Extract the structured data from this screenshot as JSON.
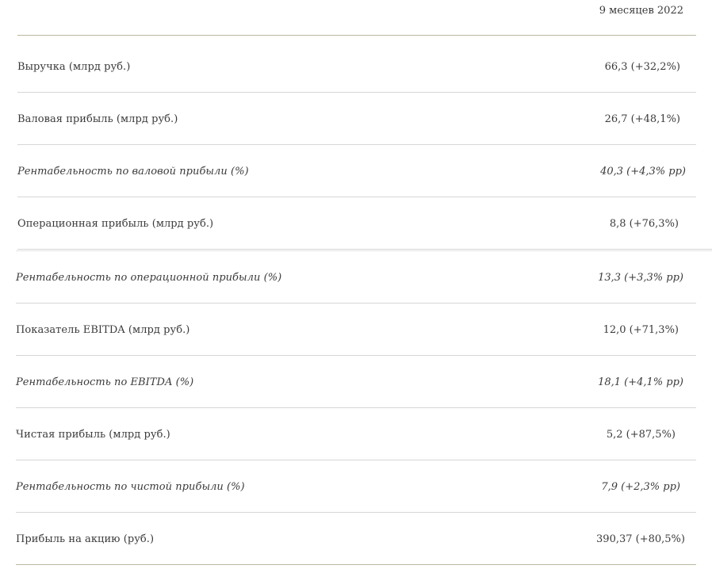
{
  "table": {
    "period_header": "9 месяцев 2022",
    "rows": [
      {
        "label": "Выручка (млрд руб.)",
        "value": "66,3 (+32,2%)",
        "italic": false
      },
      {
        "label": "Валовая прибыль (млрд руб.)",
        "value": "26,7 (+48,1%)",
        "italic": false
      },
      {
        "label": "Рентабельность по валовой прибыли (%)",
        "value": "40,3 (+4,3% pp)",
        "italic": true
      },
      {
        "label": "Операционная прибыль (млрд руб.)",
        "value": "8,8 (+76,3%)",
        "italic": false
      },
      {
        "label": "Рентабельность по операционной прибыли (%)",
        "value": "13,3 (+3,3% pp)",
        "italic": true
      },
      {
        "label": "Показатель EBITDA (млрд руб.)",
        "value": "12,0 (+71,3%)",
        "italic": false
      },
      {
        "label": "Рентабельность по EBITDA (%)",
        "value": "18,1 (+4,1% pp)",
        "italic": true
      },
      {
        "label": "Чистая прибыль (млрд руб.)",
        "value": "5,2 (+87,5%)",
        "italic": false
      },
      {
        "label": "Рентабельность по чистой прибыли (%)",
        "value": "7,9 (+2,3% pp)",
        "italic": true
      },
      {
        "label": "Прибыль на акцию (руб.)",
        "value": "390,37 (+80,5%)",
        "italic": false
      }
    ]
  }
}
